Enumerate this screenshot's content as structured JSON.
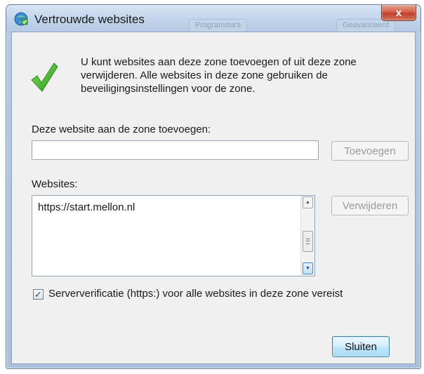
{
  "window": {
    "title": "Vertrouwde websites",
    "close_label": "x",
    "background_tabs": [
      "Programma's",
      "Geavanceerd"
    ]
  },
  "intro_text": "U kunt websites aan deze zone toevoegen of uit deze zone verwijderen. Alle websites in deze zone gebruiken de beveiligingsinstellingen voor de zone.",
  "add_section": {
    "label": "Deze website aan de zone toevoegen:",
    "input_value": "",
    "add_button_label": "Toevoegen"
  },
  "websites": {
    "label": "Websites:",
    "items": [
      "https://start.mellon.nl"
    ],
    "remove_button_label": "Verwijderen"
  },
  "https_checkbox": {
    "checked": true,
    "label": "Serververificatie (https:) voor alle websites in deze zone vereist"
  },
  "close_button_label": "Sluiten",
  "icons": [
    "trusted-sites-icon",
    "checkmark-icon",
    "close-icon",
    "scroll-up-icon",
    "scroll-down-icon"
  ]
}
